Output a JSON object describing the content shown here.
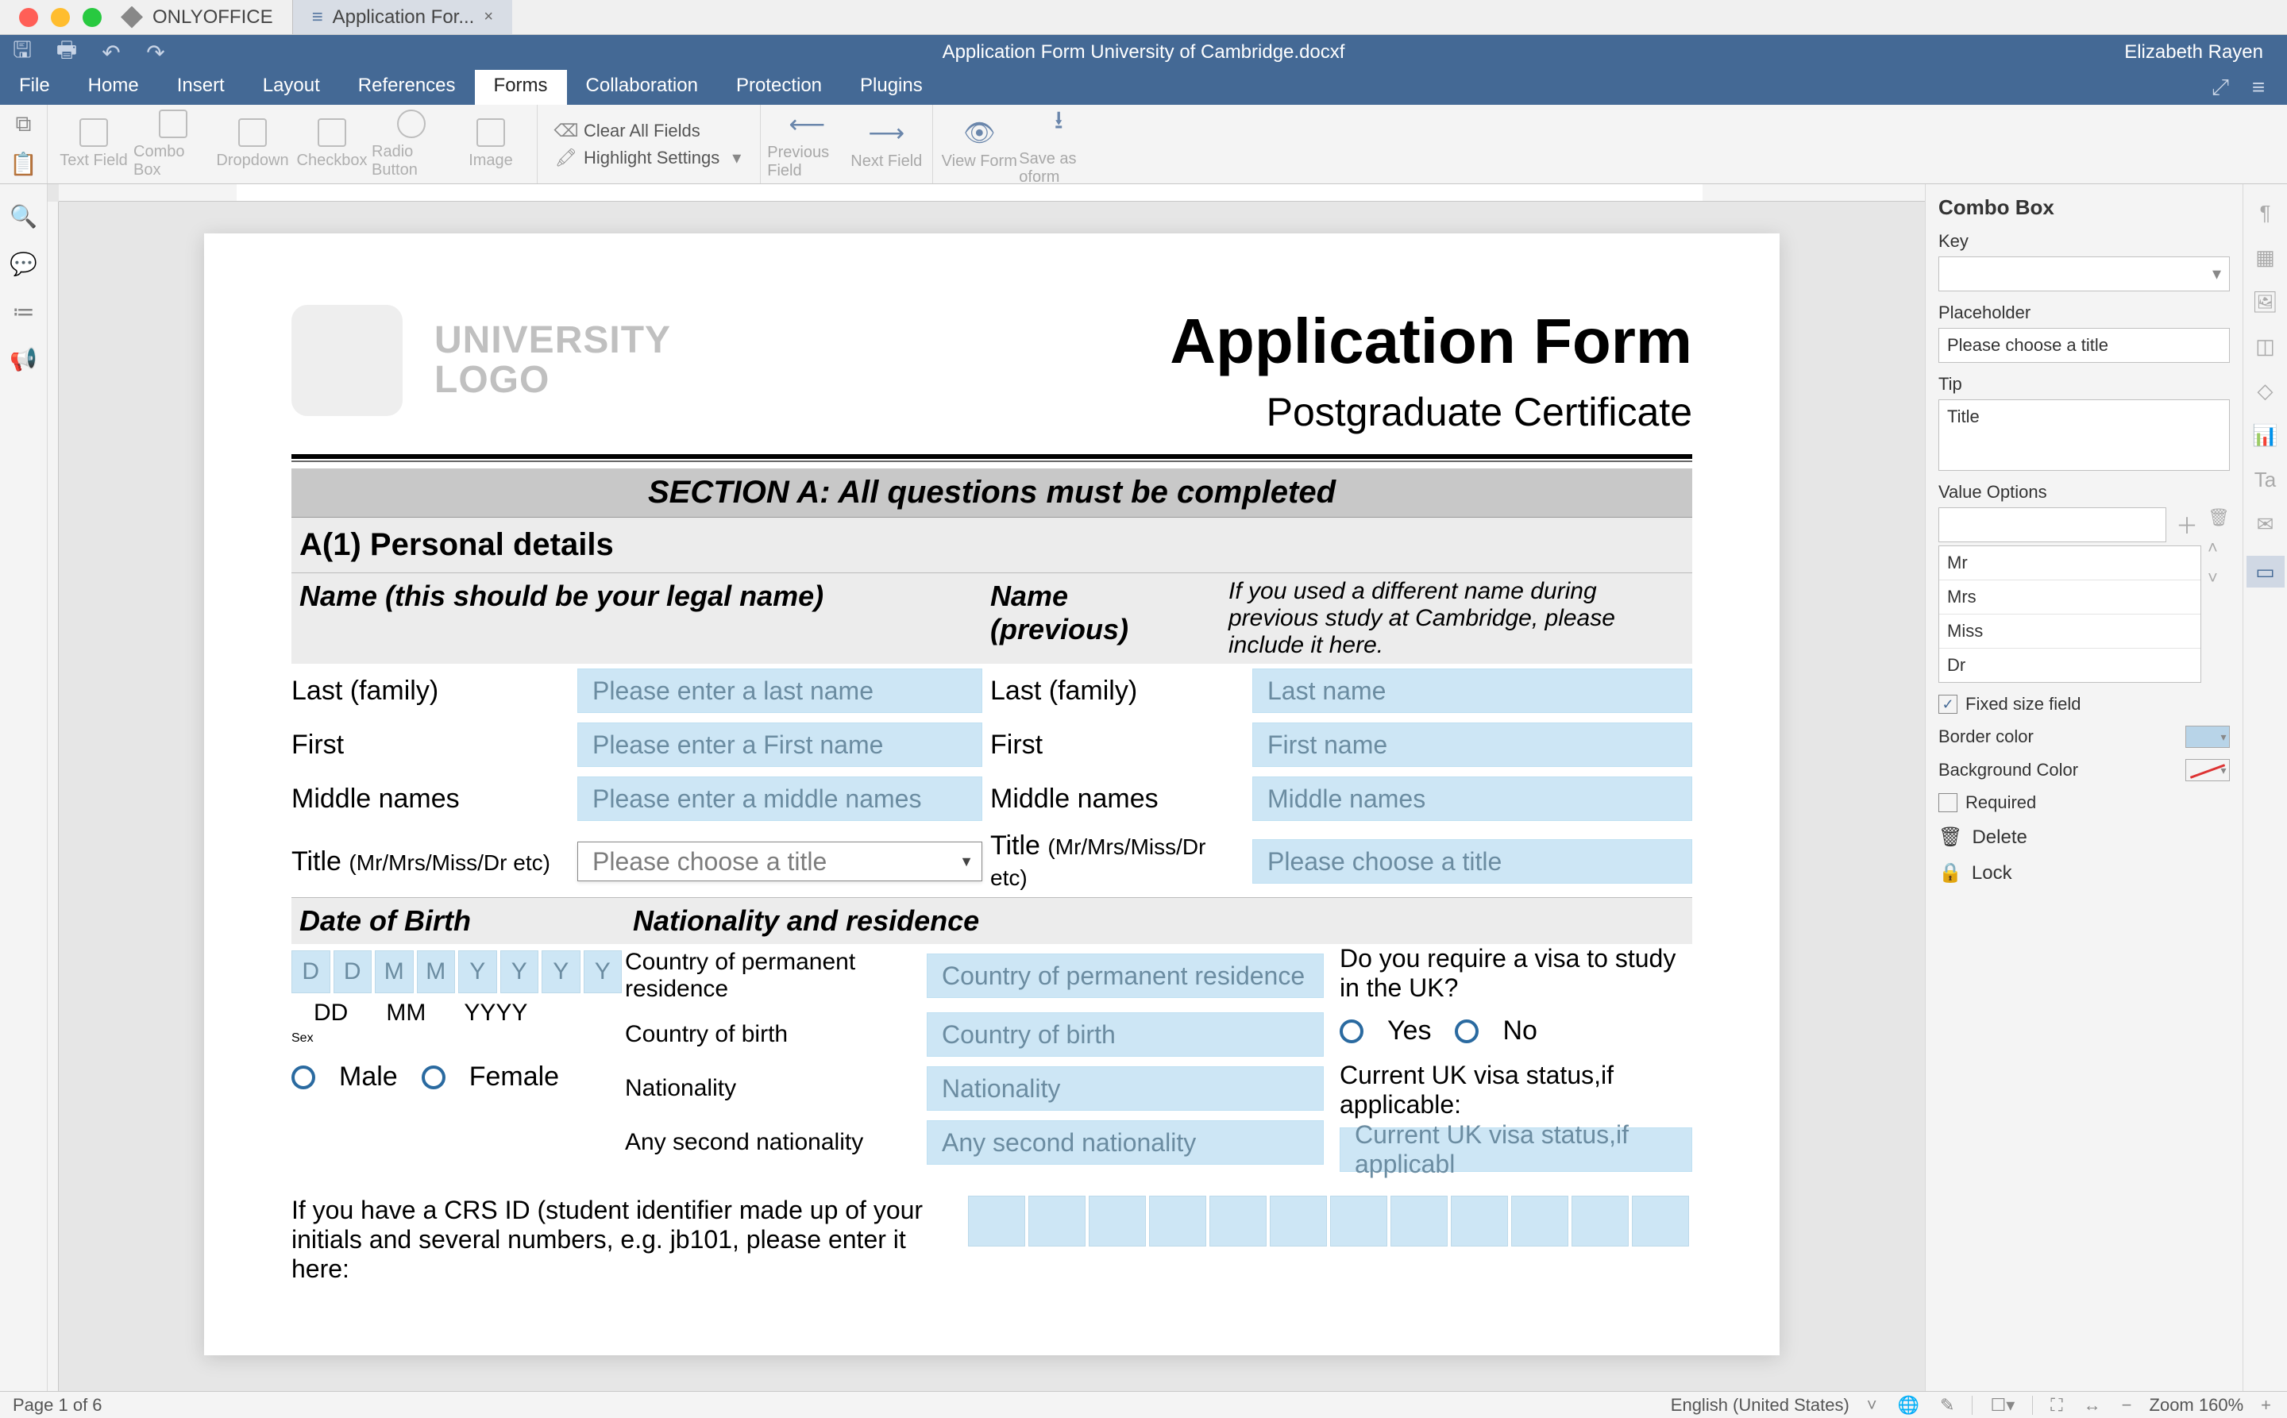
{
  "window": {
    "app_name": "ONLYOFFICE",
    "doc_tab": "Application For...",
    "doc_title": "Application Form University of Cambridge.docxf",
    "user": "Elizabeth Rayen"
  },
  "menus": [
    "File",
    "Home",
    "Insert",
    "Layout",
    "References",
    "Forms",
    "Collaboration",
    "Protection",
    "Plugins"
  ],
  "active_menu": "Forms",
  "toolbar": {
    "text_field": "Text Field",
    "combo_box": "Combo Box",
    "dropdown": "Dropdown",
    "checkbox": "Checkbox",
    "radio_button": "Radio Button",
    "image": "Image",
    "clear_all": "Clear All Fields",
    "highlight": "Highlight Settings",
    "prev_field": "Previous Field",
    "next_field": "Next Field",
    "view_form": "View Form",
    "save_oform": "Save as oform"
  },
  "doc": {
    "logo_text_1": "UNIVERSITY",
    "logo_text_2": "LOGO",
    "title": "Application Form",
    "subtitle": "Postgraduate Certificate",
    "section_a": "SECTION A: All questions must be completed",
    "a1": "A(1) Personal details",
    "name_head": "Name (this should be your legal name)",
    "name_prev_head": "Name (previous)",
    "prev_note": "If you used a different name during previous study at Cambridge, please include it here.",
    "last": "Last (family)",
    "first": "First",
    "middle": "Middle names",
    "title_label": "Title ",
    "title_hint": "(Mr/Mrs/Miss/Dr etc)",
    "ph_last": "Please enter a last name",
    "ph_first": "Please enter a First name",
    "ph_middle": "Please enter a middle names",
    "ph_title": "Please choose a title",
    "ph_last_prev": "Last name",
    "ph_first_prev": "First name",
    "ph_middle_prev": "Middle names",
    "ph_title_prev": "Please choose a title",
    "dob_head": "Date of Birth",
    "nat_head": "Nationality and residence",
    "dob_placeholders": [
      "D",
      "D",
      "M",
      "M",
      "Y",
      "Y",
      "Y",
      "Y"
    ],
    "dob_labels": [
      "DD",
      "MM",
      "YYYY"
    ],
    "sex_head": "Sex",
    "male": "Male",
    "female": "Female",
    "country_perm": "Country of permanent residence",
    "ph_country_perm": "Country of permanent residence",
    "country_birth": "Country of birth",
    "ph_country_birth": "Country of birth",
    "nationality": "Nationality",
    "ph_nationality": "Nationality",
    "second_nat": "Any second nationality",
    "ph_second_nat": "Any second nationality",
    "visa_q": "Do you require a visa to study in the UK?",
    "yes": "Yes",
    "no": "No",
    "visa_status": "Current UK visa status,if applicable:",
    "ph_visa_status": "Current UK visa status,if applicabl",
    "crs_text": "If you have a CRS ID (student identifier made up of your initials and several numbers, e.g. jb101, please enter it here:"
  },
  "panel": {
    "title": "Combo Box",
    "key": "Key",
    "placeholder_label": "Placeholder",
    "placeholder_value": "Please choose a title",
    "tip_label": "Tip",
    "tip_value": "Title",
    "value_options": "Value Options",
    "options": [
      "Mr",
      "Mrs",
      "Miss",
      "Dr"
    ],
    "fixed_size": "Fixed size field",
    "border_color": "Border color",
    "background_color": "Background Color",
    "required": "Required",
    "delete": "Delete",
    "lock": "Lock"
  },
  "statusbar": {
    "page": "Page 1 of 6",
    "language": "English (United States)",
    "zoom": "Zoom 160%"
  }
}
